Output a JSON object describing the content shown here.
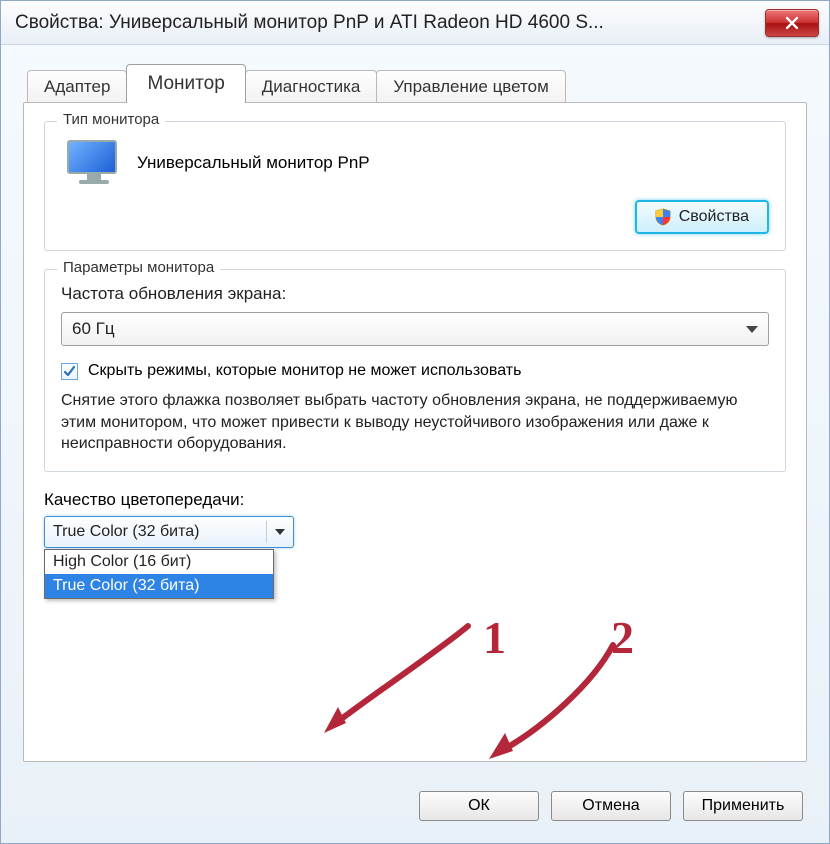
{
  "window": {
    "title": "Свойства: Универсальный монитор PnP и ATI Radeon HD 4600 S..."
  },
  "tabs": {
    "adapter": "Адаптер",
    "monitor": "Монитор",
    "diagnostics": "Диагностика",
    "colormgmt": "Управление цветом"
  },
  "monitor_group": {
    "legend": "Тип монитора",
    "device_name": "Универсальный монитор PnP",
    "properties_btn": "Свойства"
  },
  "settings_group": {
    "legend": "Параметры монитора",
    "refresh_label": "Частота обновления экрана:",
    "refresh_value": "60 Гц",
    "hide_modes_label": "Скрыть режимы, которые монитор не может использовать",
    "help_text": "Снятие этого флажка позволяет выбрать частоту обновления экрана, не поддерживаемую этим монитором, что может привести к выводу неустойчивого изображения или даже к неисправности оборудования."
  },
  "color_quality": {
    "label": "Качество цветопередачи:",
    "selected": "True Color (32 бита)",
    "options": [
      "High Color (16 бит)",
      "True Color (32 бита)"
    ]
  },
  "buttons": {
    "ok": "ОК",
    "cancel": "Отмена",
    "apply": "Применить"
  },
  "annotations": {
    "n1": "1",
    "n2": "2"
  }
}
